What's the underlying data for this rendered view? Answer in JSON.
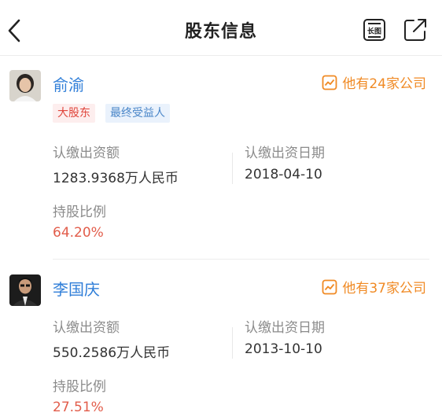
{
  "header": {
    "title": "股东信息",
    "back_icon": "chevron-left-icon",
    "long_icon_text": "长图",
    "share_icon": "share-icon"
  },
  "shareholders": [
    {
      "name": "俞渝",
      "companies": "他有24家公司",
      "tags": [
        "大股东",
        "最终受益人"
      ],
      "subscribed_label": "认缴出资额",
      "subscribed_value": "1283.9368万人民币",
      "date_label": "认缴出资日期",
      "date_value": "2018-04-10",
      "ratio_label": "持股比例",
      "ratio_value": "64.20%"
    },
    {
      "name": "李国庆",
      "companies": "他有37家公司",
      "tags": [],
      "subscribed_label": "认缴出资额",
      "subscribed_value": "550.2586万人民币",
      "date_label": "认缴出资日期",
      "date_value": "2013-10-10",
      "ratio_label": "持股比例",
      "ratio_value": "27.51%"
    }
  ],
  "colors": {
    "link_blue": "#2f7ed8",
    "orange": "#f08a24",
    "percent_red": "#e25d4b"
  }
}
